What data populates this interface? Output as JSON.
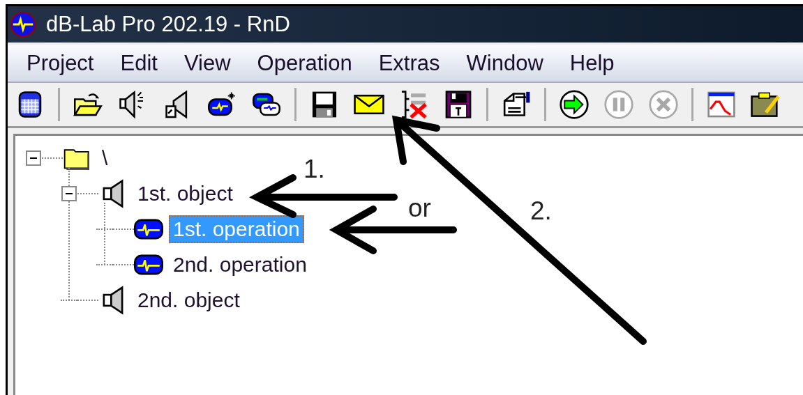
{
  "window": {
    "title": "dB-Lab Pro 202.19 - RnD"
  },
  "menu": [
    {
      "label": "Project"
    },
    {
      "label": "Edit"
    },
    {
      "label": "View"
    },
    {
      "label": "Operation"
    },
    {
      "label": "Extras"
    },
    {
      "label": "Window"
    },
    {
      "label": "Help"
    }
  ],
  "toolbar": [
    {
      "kind": "database",
      "disabled": false
    },
    {
      "kind": "separator"
    },
    {
      "kind": "open",
      "disabled": false
    },
    {
      "kind": "speaker-new",
      "disabled": false
    },
    {
      "kind": "speaker-doc",
      "disabled": false
    },
    {
      "kind": "operation-new",
      "disabled": false
    },
    {
      "kind": "operation-copy",
      "disabled": false
    },
    {
      "kind": "separator"
    },
    {
      "kind": "save",
      "disabled": false
    },
    {
      "kind": "mail",
      "disabled": false
    },
    {
      "kind": "delete",
      "disabled": false
    },
    {
      "kind": "save-text",
      "disabled": false
    },
    {
      "kind": "separator"
    },
    {
      "kind": "properties",
      "disabled": false
    },
    {
      "kind": "separator"
    },
    {
      "kind": "run",
      "disabled": false
    },
    {
      "kind": "pause",
      "disabled": true
    },
    {
      "kind": "stop",
      "disabled": true
    },
    {
      "kind": "separator"
    },
    {
      "kind": "chart",
      "disabled": false
    },
    {
      "kind": "clipboard",
      "disabled": false
    }
  ],
  "tree": [
    {
      "label": "\\",
      "kind": "folder",
      "selected": false,
      "expanded": true,
      "children": [
        {
          "label": "1st. object",
          "kind": "object",
          "selected": false,
          "expanded": true,
          "children": [
            {
              "label": "1st. operation",
              "kind": "operation",
              "selected": true
            },
            {
              "label": "2nd. operation",
              "kind": "operation",
              "selected": false
            }
          ]
        },
        {
          "label": "2nd. object",
          "kind": "object",
          "selected": false
        }
      ]
    }
  ],
  "annotations": [
    {
      "label": "1."
    },
    {
      "label": "or"
    },
    {
      "label": "2."
    }
  ]
}
